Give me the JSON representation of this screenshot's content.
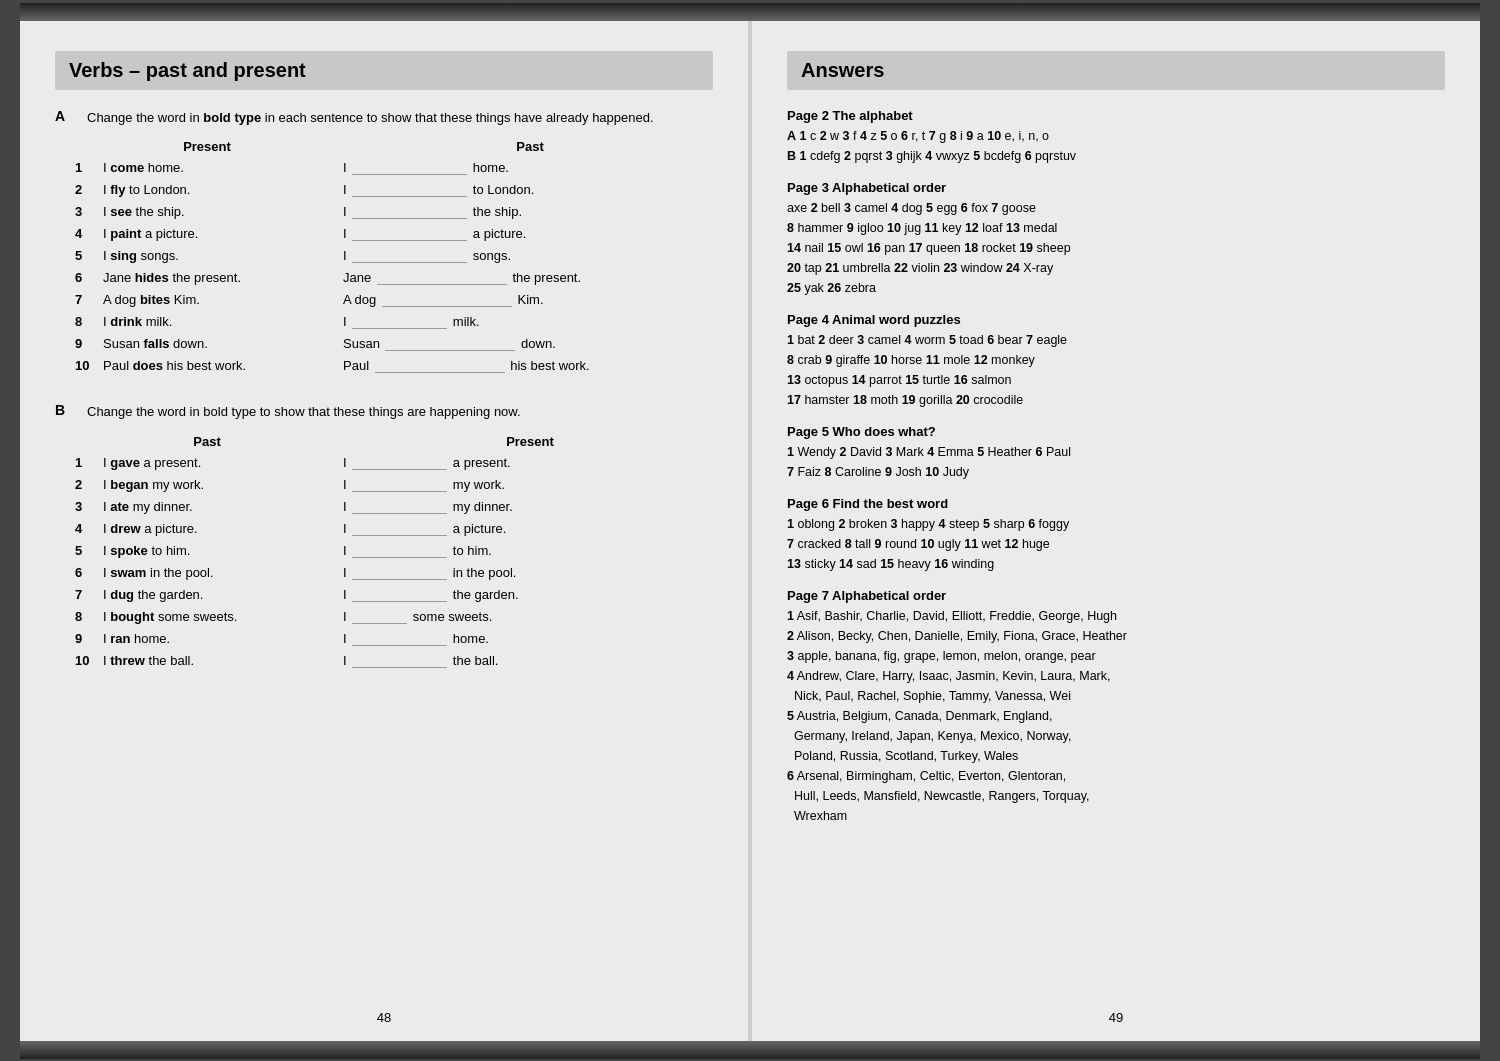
{
  "left_page": {
    "title": "Verbs – past and present",
    "section_a": {
      "label": "A",
      "intro": "Change the word in bold type in each sentence to show that these things have already happened.",
      "col1_header": "Present",
      "col2_header": "Past",
      "rows": [
        {
          "num": "1",
          "present": "I <b>come</b> home.",
          "past": "I ___ home."
        },
        {
          "num": "2",
          "present": "I <b>fly</b> to London.",
          "past": "I ___ to London."
        },
        {
          "num": "3",
          "present": "I <b>see</b> the ship.",
          "past": "I ___ the ship."
        },
        {
          "num": "4",
          "present": "I <b>paint</b> a picture.",
          "past": "I ___ a picture."
        },
        {
          "num": "5",
          "present": "I <b>sing</b> songs.",
          "past": "I ___ songs."
        },
        {
          "num": "6",
          "present": "Jane <b>hides</b> the present.",
          "past": "Jane ___ the present."
        },
        {
          "num": "7",
          "present": "A dog <b>bites</b> Kim.",
          "past": "A dog ___ Kim."
        },
        {
          "num": "8",
          "present": "I <b>drink</b> milk.",
          "past": "I ___ milk."
        },
        {
          "num": "9",
          "present": "Susan <b>falls</b> down.",
          "past": "Susan ___ down."
        },
        {
          "num": "10",
          "present": "Paul <b>does</b> his best work.",
          "past": "Paul ___ his best work."
        }
      ]
    },
    "section_b": {
      "label": "B",
      "intro": "Change the word in bold type to show that these things are happening now.",
      "col1_header": "Past",
      "col2_header": "Present",
      "rows": [
        {
          "num": "1",
          "present": "I <b>gave</b> a present.",
          "past": "I ___ a present."
        },
        {
          "num": "2",
          "present": "I <b>began</b> my work.",
          "past": "I ___ my work."
        },
        {
          "num": "3",
          "present": "I <b>ate</b> my dinner.",
          "past": "I ___ my dinner."
        },
        {
          "num": "4",
          "present": "I <b>drew</b> a picture.",
          "past": "I ___ a picture."
        },
        {
          "num": "5",
          "present": "I <b>spoke</b> to him.",
          "past": "I ___ to him."
        },
        {
          "num": "6",
          "present": "I <b>swam</b> in the pool.",
          "past": "I ___ in the pool."
        },
        {
          "num": "7",
          "present": "I <b>dug</b> the garden.",
          "past": "I ___ the garden."
        },
        {
          "num": "8",
          "present": "I <b>bought</b> some sweets.",
          "past": "I ___ some sweets."
        },
        {
          "num": "9",
          "present": "I <b>ran</b> home.",
          "past": "I ___ home."
        },
        {
          "num": "10",
          "present": "I <b>threw</b> the ball.",
          "past": "I ___ the ball."
        }
      ]
    },
    "page_number": "48"
  },
  "right_page": {
    "title": "Answers",
    "sections": [
      {
        "heading": "Page 2 The alphabet",
        "lines": [
          "A 1 c  2 w  3 f  4 z  5 o  6 r, t  7 g  8 i  9 a  10 e, i, n, o",
          "B 1 cdefg  2 pqrst  3 ghijk  4 vwxyz  5 bcdefg  6 pqrstuv"
        ]
      },
      {
        "heading": "Page 3 Alphabetical order",
        "lines": [
          "axe  2 bell  3 camel  4 dog  5 egg  6 fox  7 goose",
          "8 hammer  9 igloo  10 jug  11 key  12 loaf  13 medal",
          "14 nail  15 owl  16 pan  17 queen  18 rocket  19 sheep",
          "20 tap  21 umbrella  22 violin  23 window  24 X-ray",
          "25 yak  26 zebra"
        ]
      },
      {
        "heading": "Page 4 Animal word puzzles",
        "lines": [
          "1 bat  2 deer  3 camel  4 worm  5 toad  6 bear  7 eagle",
          "8 crab  9 giraffe  10 horse  11 mole  12 monkey",
          "13 octopus  14 parrot  15 turtle  16 salmon",
          "17 hamster  18 moth  19 gorilla  20 crocodile"
        ]
      },
      {
        "heading": "Page 5 Who does what?",
        "lines": [
          "1 Wendy  2 David  3 Mark  4 Emma  5 Heather  6 Paul",
          "7 Faiz  8 Caroline  9 Josh  10 Judy"
        ]
      },
      {
        "heading": "Page 6 Find the best word",
        "lines": [
          "1 oblong  2 broken  3 happy  4 steep  5 sharp  6 foggy",
          "7 cracked  8 tall  9 round  10 ugly  11 wet  12 huge",
          "13 sticky  14 sad  15 heavy  16 winding"
        ]
      },
      {
        "heading": "Page 7 Alphabetical order",
        "lines": [
          "1 Asif, Bashir, Charlie, David, Elliott, Freddie, George, Hugh",
          "2 Alison, Becky, Chen, Danielle, Emily, Fiona, Grace, Heather",
          "3 apple, banana, fig, grape, lemon, melon, orange, pear",
          "4 Andrew, Clare, Harry, Isaac, Jasmin, Kevin, Laura, Mark,",
          "   Nick, Paul, Rachel, Sophie, Tammy, Vanessa, Wei",
          "5 Austria, Belgium, Canada, Denmark, England,",
          "   Germany, Ireland, Japan, Kenya, Mexico, Norway,",
          "   Poland, Russia, Scotland, Turkey, Wales",
          "6 Arsenal, Birmingham, Celtic, Everton, Glentoran,",
          "   Hull, Leeds, Mansfield, Newcastle, Rangers, Torquay,",
          "   Wrexham"
        ]
      }
    ],
    "page_number": "49"
  }
}
